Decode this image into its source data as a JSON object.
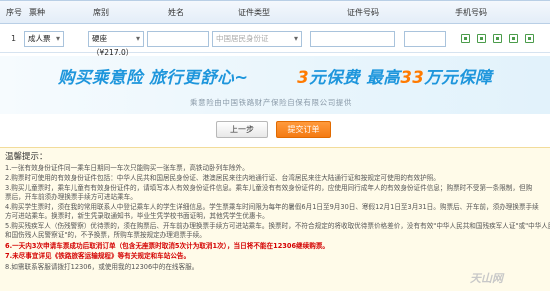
{
  "header": {
    "seq": "序号",
    "ticket_type": "票种",
    "seat_type": "席别",
    "name": "姓名",
    "id_type": "证件类型",
    "id_number": "证件号码",
    "phone": "手机号码"
  },
  "passenger": {
    "index": "1",
    "ticket_type": "成人票",
    "seat": "硬座（¥217.0）",
    "name": "",
    "id_type_placeholder": "中国居民身份证",
    "id_number": "",
    "phone": ""
  },
  "banner": {
    "slogan_a": "购买乘意险  旅行更舒心~",
    "slogan_b1": "3",
    "slogan_b2": "元保费  最高",
    "slogan_b3": "33",
    "slogan_b4": "万元保障",
    "provider": "乘意险由中国铁路财产保险自保有限公司提供"
  },
  "buttons": {
    "prev": "上一步",
    "submit": "提交订单"
  },
  "tips": {
    "title": "温馨提示：",
    "items": [
      "1.一张有效身份证件同一乘车日期同一车次只能购买一张车票，高铁动卧列车除外。",
      "2.购票时可使用的有效身份证件包括：中华人民共和国居民身份证、港澳居民来往内地通行证、台湾居民来往大陆通行证和按规定可使用的有效护照。",
      "3.购买儿童票时，乘车儿童有有效身份证件的，请填写本人有效身份证件信息。乘车儿童没有有效身份证件的，应使用同行成年人的有效身份证件信息；购票时不受第一条限制，但购",
      "  票后，开车前须办理换票手续方可进站乘车。",
      "4.购买学生票时，须在我的常用联系人中登记乘车人的学生详细信息。学生票乘车时间限为每年的暑假6月1日至9月30日、寒假12月1日至3月31日。购票后、开车前，须办理换票手续",
      "  方可进站乘车。换票时，新生凭录取通知书，毕业生凭学校书面证明，其他凭学生优惠卡。",
      "5.购买残疾军人（伤残警察）优待票的，须在购票后、开车前办理换票手续方可进站乘车。换票时，不符合规定的将收取优待票价格差价，没有有效\"中华人民共和国残疾军人证\"或\"中华人民共",
      "  和国伤残人民警察证\"的，不予换票，所购车票按规定办理退票手续。"
    ],
    "red_a": "6.一天内3次申请车票成功后取消订单（包含无座票时取消5次计为取消1次），当日将不能在12306继续购票。",
    "red_b": "7.未尽事宜详见《铁路旅客运输规程》等有关规定和车站公告。",
    "item8": "8.如需联系客服请拨打12306，或使用我的12306中的在线客服。"
  },
  "watermark": "天山网"
}
